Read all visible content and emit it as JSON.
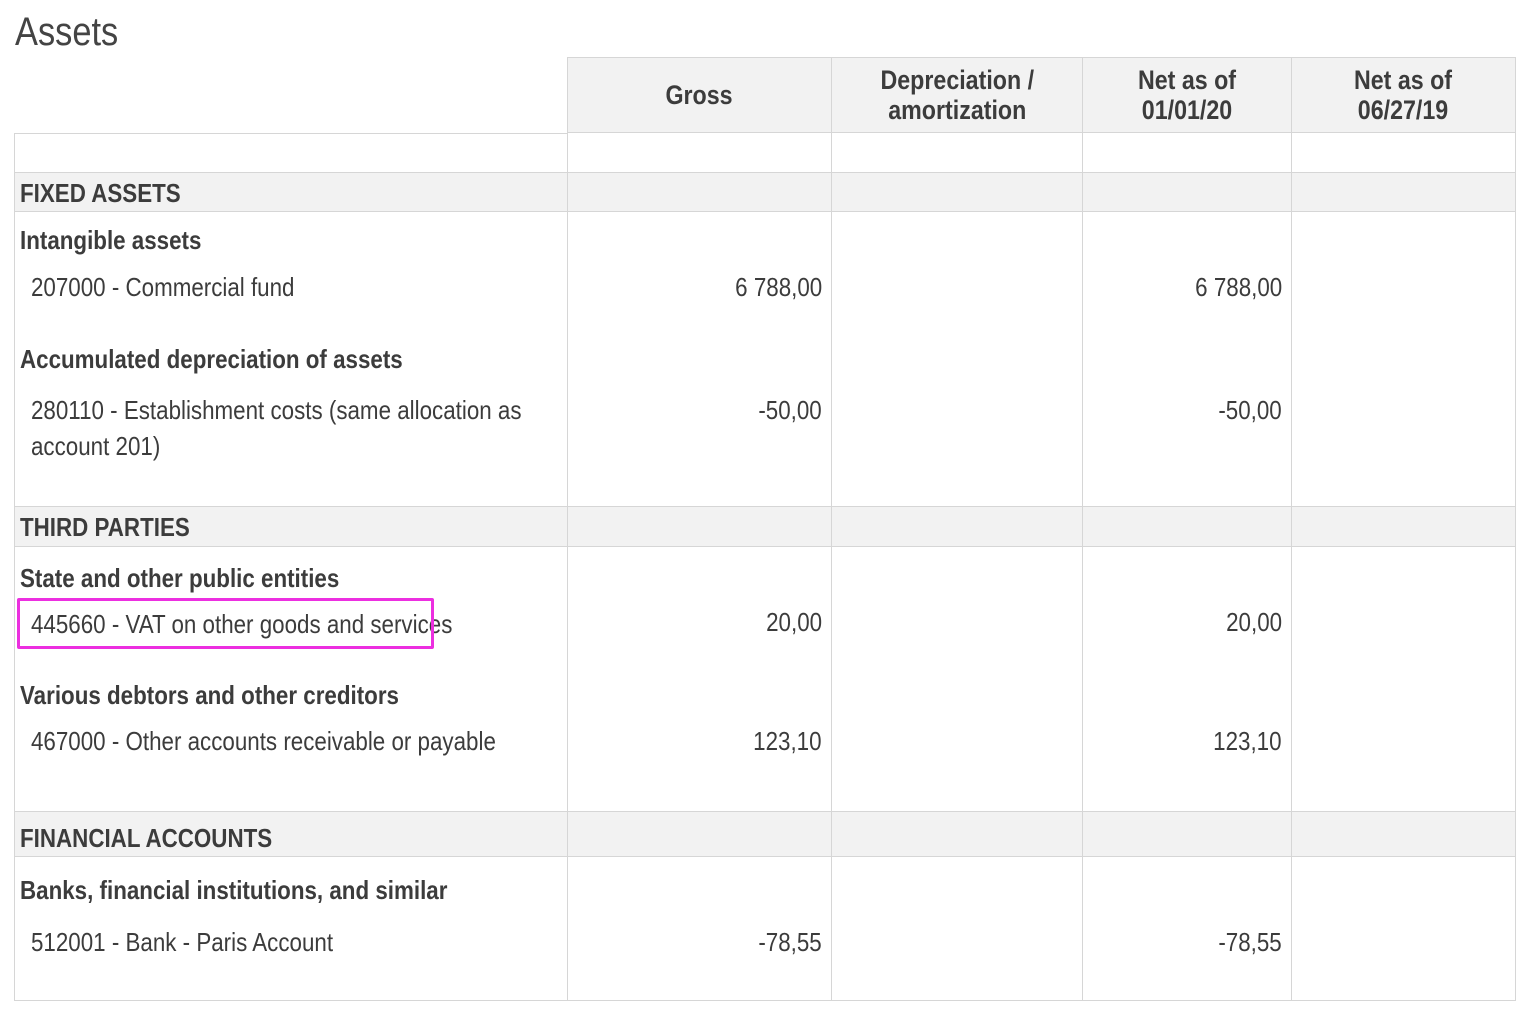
{
  "page": {
    "title": "Assets"
  },
  "columns": {
    "gross": "Gross",
    "depreciation": "Depreciation /\namortization",
    "net_current": "Net as of\n01/01/20",
    "net_previous": "Net as of\n06/27/19"
  },
  "sections": {
    "fixed_assets": {
      "label": "FIXED ASSETS",
      "intangible": {
        "label": "Intangible assets",
        "account": {
          "label": "207000 - Commercial fund",
          "gross": "6 788,00",
          "net_current": "6 788,00"
        }
      },
      "accumulated": {
        "label": "Accumulated depreciation of assets",
        "account": {
          "label_line1": "280110 - Establishment costs (same allocation as",
          "label_line2": "account 201)",
          "gross": "-50,00",
          "net_current": "-50,00"
        }
      }
    },
    "third_parties": {
      "label": "THIRD PARTIES",
      "state": {
        "label": "State and other public entities",
        "account": {
          "label": "445660 - VAT on other goods and services",
          "gross": "20,00",
          "net_current": "20,00"
        }
      },
      "various": {
        "label": "Various debtors and other creditors",
        "account": {
          "label": "467000 - Other accounts receivable or payable",
          "gross": "123,10",
          "net_current": "123,10"
        }
      }
    },
    "financial_accounts": {
      "label": "FINANCIAL ACCOUNTS",
      "banks": {
        "label": "Banks, financial institutions, and similar",
        "account": {
          "label": "512001 - Bank - Paris Account",
          "gross": "-78,55",
          "net_current": "-78,55"
        }
      }
    }
  },
  "highlight": {
    "color": "#ec2fe0"
  }
}
